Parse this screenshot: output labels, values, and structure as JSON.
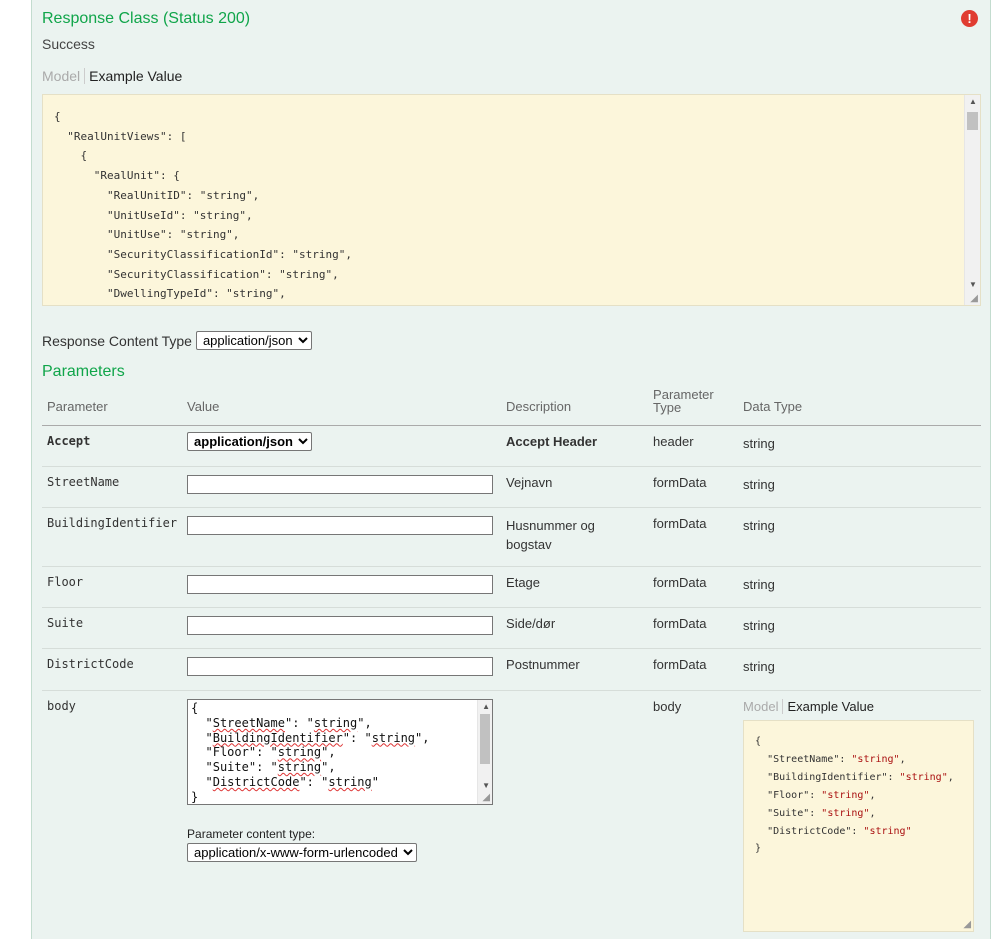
{
  "response_class": {
    "title": "Response Class (Status 200)",
    "status_text": "Success",
    "tabs": {
      "model": "Model",
      "example": "Example Value"
    },
    "example_json": "{\n  \"RealUnitViews\": [\n    {\n      \"RealUnit\": {\n        \"RealUnitID\": \"string\",\n        \"UnitUseId\": \"string\",\n        \"UnitUse\": \"string\",\n        \"SecurityClassificationId\": \"string\",\n        \"SecurityClassification\": \"string\",\n        \"DwellingTypeId\": \"string\","
  },
  "error_icon": "exclamation-icon",
  "response_content_type": {
    "label": "Response Content Type",
    "selected": "application/json"
  },
  "parameters": {
    "title": "Parameters",
    "columns": [
      "Parameter",
      "Value",
      "Description",
      "Parameter\nType",
      "Data Type"
    ],
    "rows": [
      {
        "name": "Accept",
        "value": "application/json",
        "description": "Accept Header",
        "param_type": "header",
        "data_type": "string"
      },
      {
        "name": "StreetName",
        "value": "",
        "description": "Vejnavn",
        "param_type": "formData",
        "data_type": "string"
      },
      {
        "name": "BuildingIdentifier",
        "value": "",
        "description": "Husnummer og bogstav",
        "param_type": "formData",
        "data_type": "string"
      },
      {
        "name": "Floor",
        "value": "",
        "description": "Etage",
        "param_type": "formData",
        "data_type": "string"
      },
      {
        "name": "Suite",
        "value": "",
        "description": "Side/dør",
        "param_type": "formData",
        "data_type": "string"
      },
      {
        "name": "DistrictCode",
        "value": "",
        "description": "Postnummer",
        "param_type": "formData",
        "data_type": "string"
      }
    ],
    "body_row": {
      "name": "body",
      "lines": [
        "{",
        "  \"StreetName\": \"string\",",
        "  \"BuildingIdentifier\": \"string\",",
        "  \"Floor\": \"string\",",
        "  \"Suite\": \"string\",",
        "  \"DistrictCode\": \"string\"",
        "}"
      ],
      "param_content_type_label": "Parameter content type:",
      "param_content_type_selected": "application/x-www-form-urlencoded",
      "param_type": "body",
      "tabs": {
        "model": "Model",
        "example": "Example Value"
      },
      "example": [
        {
          "key": "StreetName",
          "value": "string"
        },
        {
          "key": "BuildingIdentifier",
          "value": "string"
        },
        {
          "key": "Floor",
          "value": "string"
        },
        {
          "key": "Suite",
          "value": "string"
        },
        {
          "key": "DistrictCode",
          "value": "string"
        }
      ]
    }
  },
  "colors": {
    "accent_green": "#10a54a",
    "panel_bg": "#ebf3f0",
    "snippet_bg": "#fcf6db",
    "error_red": "#e03c31"
  }
}
